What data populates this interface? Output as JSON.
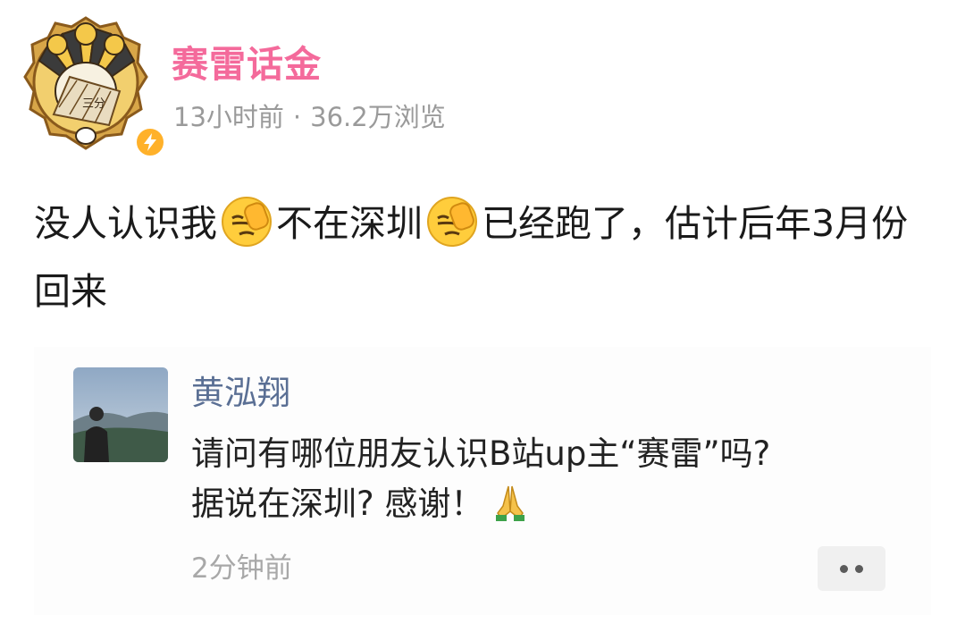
{
  "author": {
    "name": "赛雷话金",
    "avatar_icon": "sailei-fan-avatar-icon",
    "verified_icon": "lightning-badge-icon",
    "name_color": "#f46a9b"
  },
  "post": {
    "meta": {
      "time": "13小时前",
      "separator": "·",
      "views": "36.2万浏览"
    },
    "text": {
      "part1": "没人认识我",
      "part2": "不在深圳",
      "part3": "已经跑了，估计后年3月份回来"
    },
    "emoji_icon": "facepalm-emoji-icon"
  },
  "comment": {
    "name": "黄泓翔",
    "name_color": "#5a6f94",
    "text_line1": "请问有哪位朋友认识B站up主“赛雷”吗?",
    "text_line2": "据说在深圳? 感谢！",
    "end_icon": "praying-hands-icon",
    "time": "2分钟前",
    "more_icon": "more-dots-icon"
  }
}
